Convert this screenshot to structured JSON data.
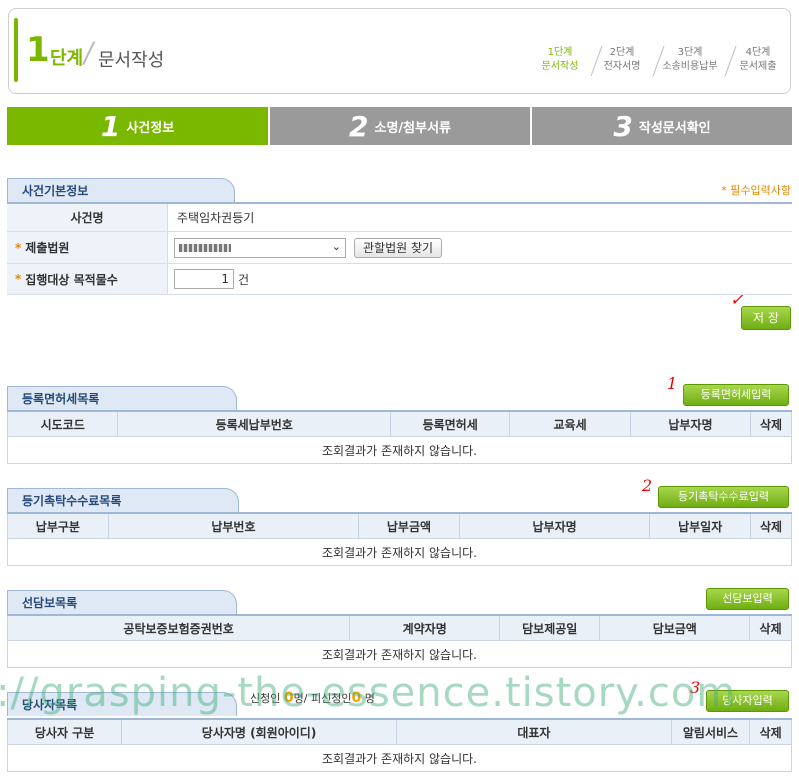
{
  "header": {
    "step_num": "1",
    "step_word": "단계",
    "title": "문서작성",
    "steps": [
      {
        "top": "1단계",
        "bottom": "문서작성"
      },
      {
        "top": "2단계",
        "bottom": "전자서명"
      },
      {
        "top": "3단계",
        "bottom": "소송비용납부"
      },
      {
        "top": "4단계",
        "bottom": "문서제출"
      }
    ]
  },
  "tabs": [
    {
      "num": "1",
      "label": "사건정보"
    },
    {
      "num": "2",
      "label": "소명/첨부서류"
    },
    {
      "num": "3",
      "label": "작성문서확인"
    }
  ],
  "case_info": {
    "title": "사건기본정보",
    "required_note": "* 필수입력사항",
    "rows": {
      "case_name_label": "사건명",
      "case_name_value": "주택임차권등기",
      "court_label": "제출법원",
      "court_button": "관할법원 찾기",
      "count_label": "집행대상 목적물수",
      "count_value": "1",
      "count_unit": "건"
    },
    "save_button": "저 장"
  },
  "annotations": {
    "check": "✓",
    "one": "1",
    "two": "2",
    "three": "3"
  },
  "reg_tax": {
    "title": "등록면허세목록",
    "button": "등록면허세입력",
    "columns": [
      "시도코드",
      "등록세납부번호",
      "등록면허세",
      "교육세",
      "납부자명",
      "삭제"
    ],
    "empty": "조회결과가 존재하지 않습니다."
  },
  "fee": {
    "title": "등기촉탁수수료목록",
    "button": "등기촉탁수수료입력",
    "columns": [
      "납부구분",
      "납부번호",
      "납부금액",
      "납부자명",
      "납부일자",
      "삭제"
    ],
    "empty": "조회결과가 존재하지 않습니다."
  },
  "collateral": {
    "title": "선담보목록",
    "button": "선담보입력",
    "columns": [
      "공탁보증보험증권번호",
      "계약자명",
      "담보제공일",
      "담보금액",
      "삭제"
    ],
    "empty": "조회결과가 존재하지 않습니다."
  },
  "parties": {
    "title": "당사자목록",
    "applicant_label": "신청인",
    "applicant_count": "0",
    "unit1": "명/",
    "respondent_label": "피신청인",
    "respondent_count": "0",
    "unit2": "명",
    "button": "당사자입력",
    "columns": [
      "당사자 구분",
      "당사자명 (회원아이디)",
      "대표자",
      "알림서비스",
      "삭제"
    ],
    "empty": "조회결과가 존재하지 않습니다."
  },
  "watermark": "://grasping-the-essence.tistory.com"
}
